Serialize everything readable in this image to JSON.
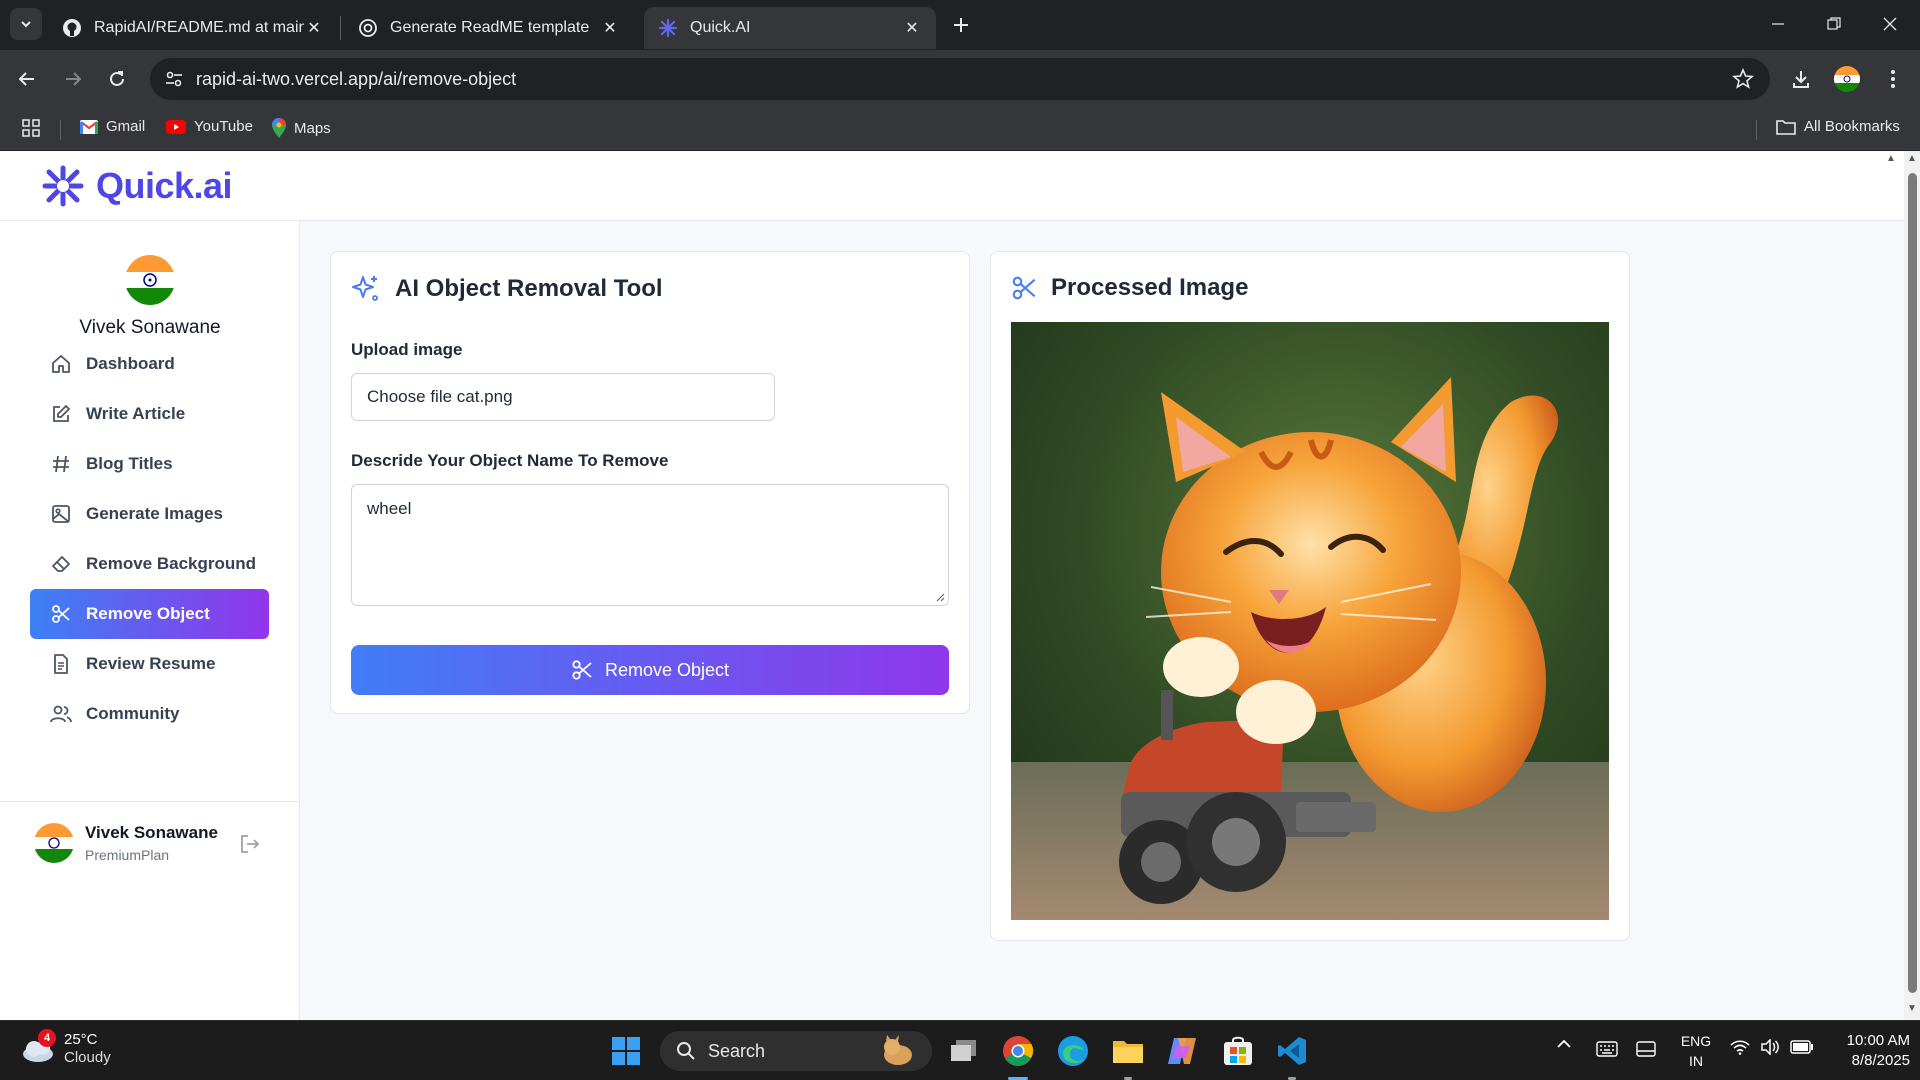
{
  "browser": {
    "tabs": [
      {
        "title": "RapidAI/README.md at main · ",
        "icon": "github-icon"
      },
      {
        "title": "Generate ReadME template",
        "icon": "chatgpt-icon"
      },
      {
        "title": "Quick.AI",
        "icon": "quickai-icon",
        "active": true
      }
    ],
    "url": "rapid-ai-two.vercel.app/ai/remove-object",
    "bookmarks": [
      {
        "label": "Gmail",
        "icon": "gmail-icon"
      },
      {
        "label": "YouTube",
        "icon": "youtube-icon"
      },
      {
        "label": "Maps",
        "icon": "maps-icon"
      }
    ],
    "all_bookmarks": "All Bookmarks"
  },
  "app": {
    "logo_text": "Quick.ai",
    "brand_color": "#4f46e5"
  },
  "sidebar": {
    "user_name": "Vivek Sonawane",
    "items": [
      {
        "label": "Dashboard",
        "icon": "home-icon"
      },
      {
        "label": "Write Article",
        "icon": "edit-icon"
      },
      {
        "label": "Blog Titles",
        "icon": "hash-icon"
      },
      {
        "label": "Generate Images",
        "icon": "image-icon"
      },
      {
        "label": "Remove Background",
        "icon": "eraser-icon"
      },
      {
        "label": "Remove Object",
        "icon": "scissors-icon",
        "active": true
      },
      {
        "label": "Review Resume",
        "icon": "file-text-icon"
      },
      {
        "label": "Community",
        "icon": "users-icon"
      }
    ],
    "footer": {
      "name": "Vivek Sonawane",
      "plan": "PremiumPlan"
    }
  },
  "tool": {
    "title": "AI Object Removal Tool",
    "upload_label": "Upload image",
    "file_value": "Choose file cat.png",
    "describe_label": "Descride Your Object Name To Remove",
    "describe_value": "wheel",
    "button_label": "Remove Object",
    "accent_gradient": [
      "#417df6",
      "#8e37eb"
    ]
  },
  "result": {
    "title": "Processed Image",
    "image_alt": "cartoon orange kitten riding a toy car"
  },
  "taskbar": {
    "weather_temp": "25°C",
    "weather_cond": "Cloudy",
    "weather_badge": "4",
    "search_label": "Search",
    "lang_top": "ENG",
    "lang_bottom": "IN",
    "time": "10:00 AM",
    "date": "8/8/2025"
  }
}
